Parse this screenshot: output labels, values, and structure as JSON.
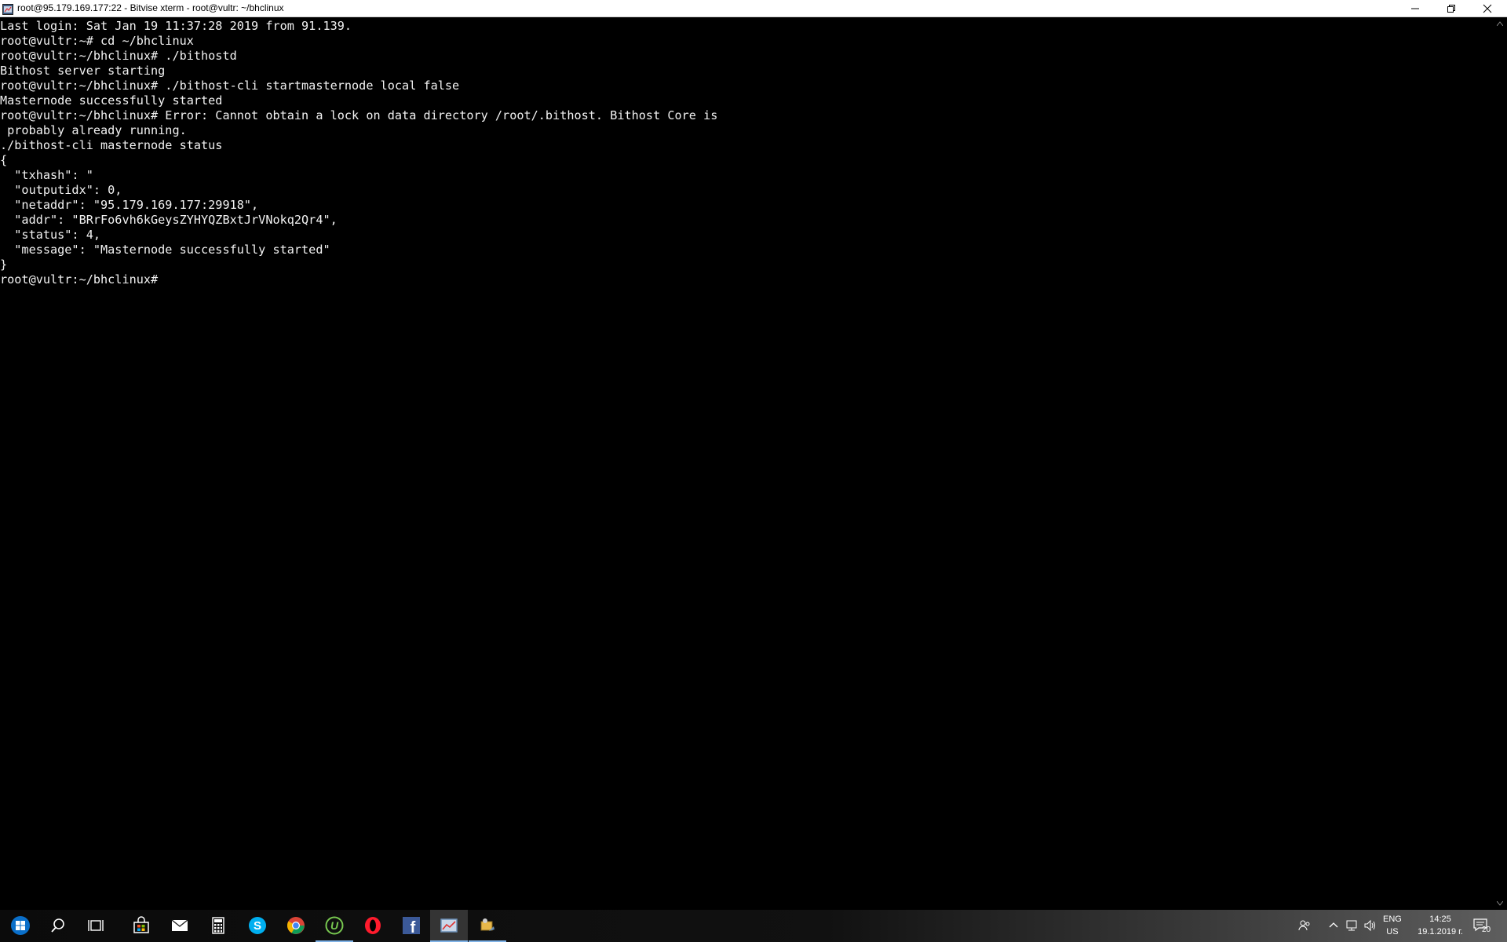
{
  "window": {
    "title": "root@95.179.169.177:22 - Bitvise xterm - root@vultr: ~/bhclinux"
  },
  "terminal": {
    "lines": [
      "Last login: Sat Jan 19 11:37:28 2019 from 91.139.",
      "root@vultr:~# cd ~/bhclinux",
      "root@vultr:~/bhclinux# ./bithostd",
      "Bithost server starting",
      "root@vultr:~/bhclinux# ./bithost-cli startmasternode local false",
      "Masternode successfully started",
      "root@vultr:~/bhclinux# Error: Cannot obtain a lock on data directory /root/.bithost. Bithost Core is",
      " probably already running.",
      "./bithost-cli masternode status",
      "{",
      "  \"txhash\": \"",
      "  \"outputidx\": 0,",
      "  \"netaddr\": \"95.179.169.177:29918\",",
      "  \"addr\": \"BRrFo6vh6kGeysZYHYQZBxtJrVNokq2Qr4\",",
      "  \"status\": 4,",
      "  \"message\": \"Masternode successfully started\"",
      "}",
      "root@vultr:~/bhclinux#"
    ]
  },
  "taskbar": {
    "apps": [
      {
        "name": "start-icon",
        "color": "#0078d7"
      },
      {
        "name": "search-icon",
        "color": "#ffffff"
      },
      {
        "name": "task-view-icon",
        "color": "#ffffff"
      },
      {
        "name": "store-icon",
        "color": "#ffffff"
      },
      {
        "name": "mail-icon",
        "color": "#ffffff"
      },
      {
        "name": "calculator-icon",
        "color": "#ffffff"
      },
      {
        "name": "skype-icon",
        "color": "#00aff0"
      },
      {
        "name": "chrome-icon",
        "color": "#4caf50"
      },
      {
        "name": "utorrent-icon",
        "color": "#78c850"
      },
      {
        "name": "opera-icon",
        "color": "#ff1b2d"
      },
      {
        "name": "facebook-icon",
        "color": "#3b5998"
      },
      {
        "name": "bitvise-xterm-icon",
        "color": "#6b8fb5"
      },
      {
        "name": "bitvise-client-icon",
        "color": "#e8b84a"
      }
    ],
    "tray": {
      "lang_line1": "ENG",
      "lang_line2": "US",
      "time": "14:25",
      "date": "19.1.2019 г.",
      "notifications": "20"
    }
  }
}
